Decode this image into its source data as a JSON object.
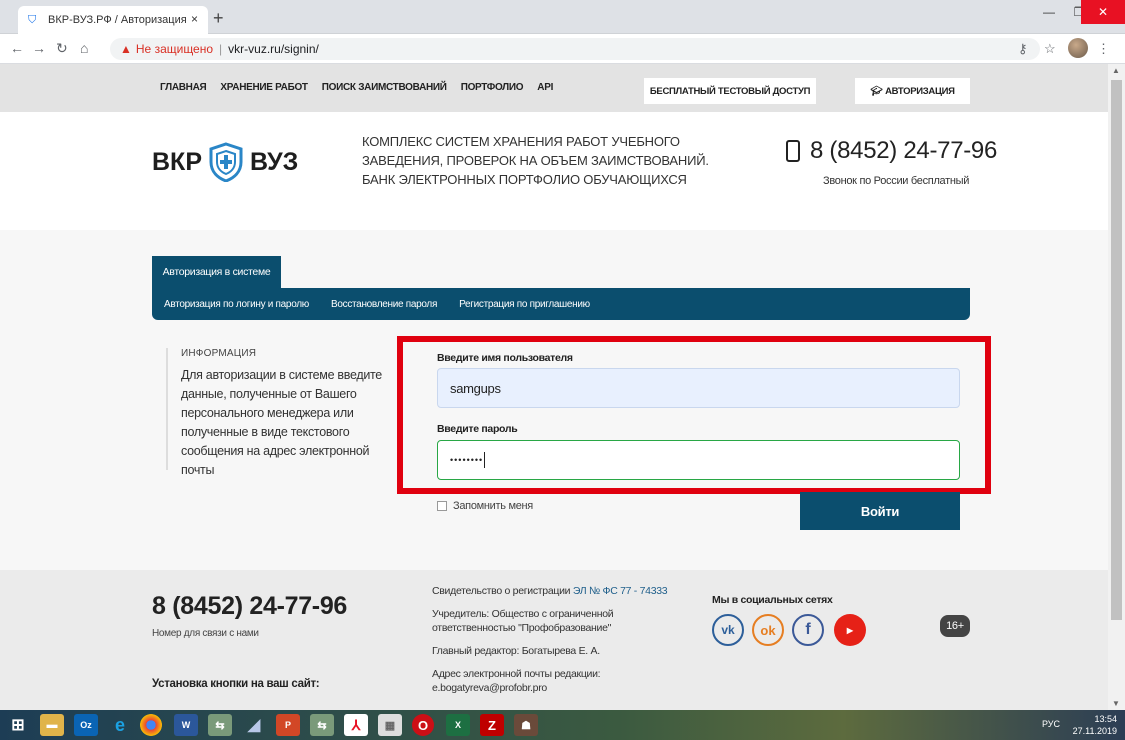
{
  "browser": {
    "tab_title": "ВКР-ВУЗ.РФ / Авторизация",
    "tab_close": "×",
    "new_tab": "+",
    "not_secure": "Не защищено",
    "url_separator": "|",
    "url": "vkr-vuz.ru/signin/"
  },
  "topnav": {
    "links": [
      "ГЛАВНАЯ",
      "ХРАНЕНИЕ РАБОТ",
      "ПОИСК ЗАИМСТВОВАНИЙ",
      "ПОРТФОЛИО",
      "API"
    ],
    "trial_button": "БЕСПЛАТНЫЙ ТЕСТОВЫЙ ДОСТУП",
    "auth_button": "АВТОРИЗАЦИЯ"
  },
  "header": {
    "logo_left": "ВКР",
    "logo_right": "ВУЗ",
    "tagline": [
      "КОМПЛЕКС СИСТЕМ ХРАНЕНИЯ РАБОТ УЧЕБНОГО",
      "ЗАВЕДЕНИЯ, ПРОВЕРОК НА ОБЪЕМ ЗАИМСТВОВАНИЙ.",
      "БАНК ЭЛЕКТРОННЫХ ПОРТФОЛИО ОБУЧАЮЩИХСЯ"
    ],
    "phone": "8 (8452) 24-77-96",
    "phone_note": "Звонок по России бесплатный"
  },
  "auth": {
    "active_tab": "Авторизация в системе",
    "subnav": [
      "Авторизация по логину и паролю",
      "Восстановление пароля",
      "Регистрация по приглашению"
    ],
    "info_title": "ИНФОРМАЦИЯ",
    "info_lines": [
      "Для авторизации в системе введите",
      "данные, полученные от Вашего",
      "персонального менеджера или",
      "полученные в виде текстового",
      "сообщения на адрес электронной почты"
    ],
    "username_label": "Введите имя пользователя",
    "username_value": "samgups",
    "password_label": "Введите пароль",
    "password_value": "••••••••",
    "remember_label": "Запомнить меня",
    "login_button": "Войти"
  },
  "footer": {
    "phone": "8 (8452) 24-77-96",
    "phone_note": "Номер для связи с нами",
    "install_title": "Установка кнопки на ваш сайт:",
    "registration_prefix": "Свидетельство о регистрации ",
    "registration_link": "ЭЛ № ФС 77 - 74333",
    "founder": "Учредитель: Общество с ограниченной ответственностью \"Профобразование\"",
    "editor": "Главный редактор: Богатырева Е. А.",
    "email_label": "Адрес электронной почты редакции:",
    "email": "e.bogatyreva@profobr.pro",
    "social_title": "Мы в социальных сетях",
    "age_badge": "16+"
  },
  "taskbar": {
    "lang": "РУС",
    "time": "13:54",
    "date": "27.11.2019"
  },
  "colors": {
    "brand_dark_blue": "#0b4e6e",
    "highlight_red": "#e0000f",
    "valid_green": "#28a745"
  }
}
